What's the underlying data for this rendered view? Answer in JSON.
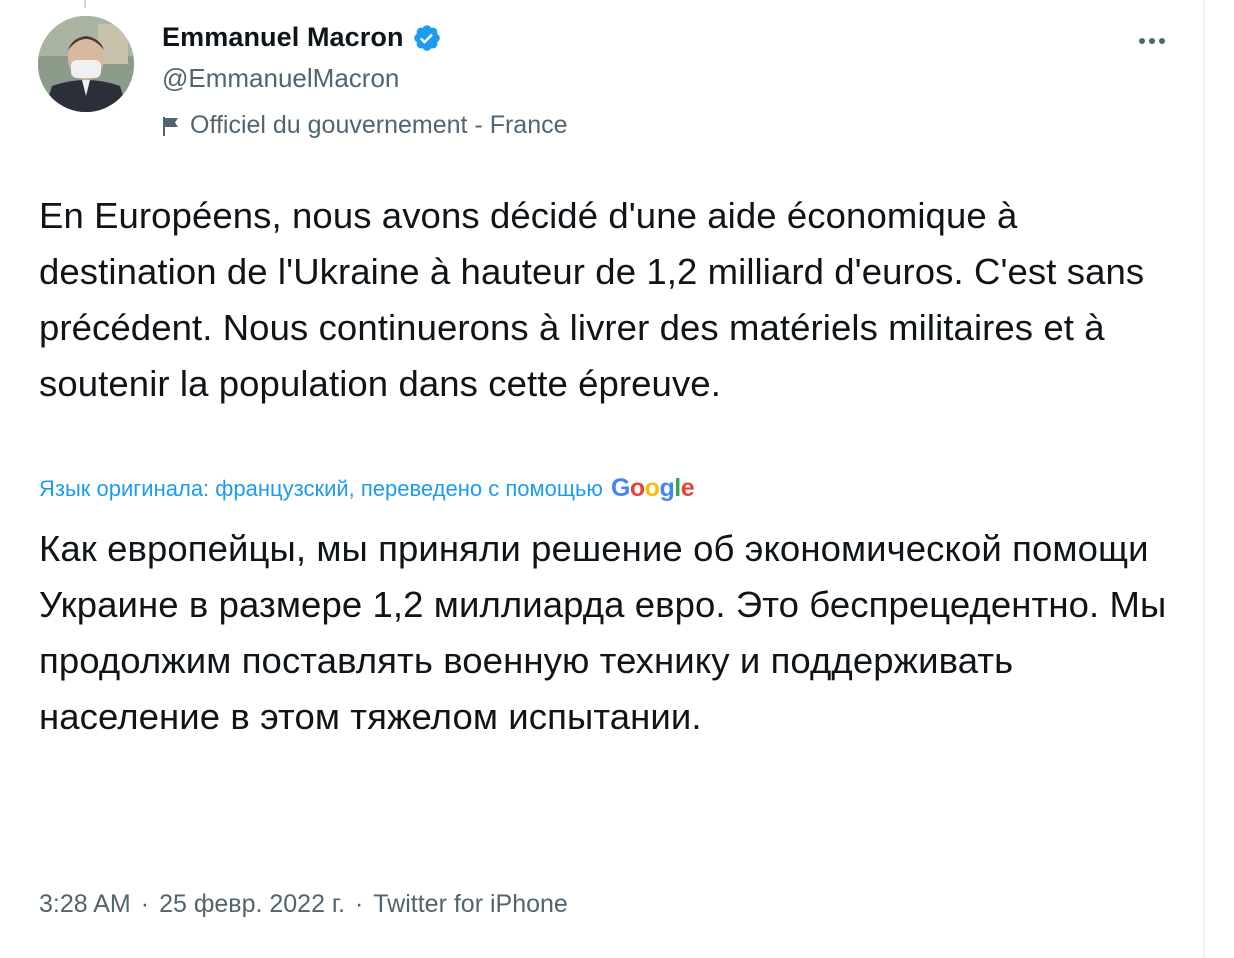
{
  "author": {
    "display_name": "Emmanuel Macron",
    "handle": "@EmmanuelMacron",
    "label": "Officiel du gouvernement - France",
    "verified_icon": "verified-badge-icon",
    "flag_icon": "flag-icon"
  },
  "tweet": {
    "text": "En Européens, nous avons décidé d'une aide économique à destination de l'Ukraine à hauteur de 1,2 milliard d'euros. C'est sans précédent. Nous continuerons à livrer des matériels militaires et à soutenir la population dans cette épreuve.",
    "translation_note": "Язык оригинала: французский, переведено с помощью",
    "translation_provider": "Google",
    "translated_text": "Как европейцы, мы приняли решение об экономической помощи Украине в размере 1,2 миллиарда евро. Это беспрецедентно. Мы продолжим поставлять военную технику и поддерживать население в этом тяжелом испытании."
  },
  "meta": {
    "time": "3:28 AM",
    "date": "25 февр. 2022 г.",
    "source": "Twitter for iPhone",
    "separator": "·"
  },
  "colors": {
    "accent": "#1d9bf0",
    "secondary_text": "#536471",
    "primary_text": "#0f1419"
  }
}
